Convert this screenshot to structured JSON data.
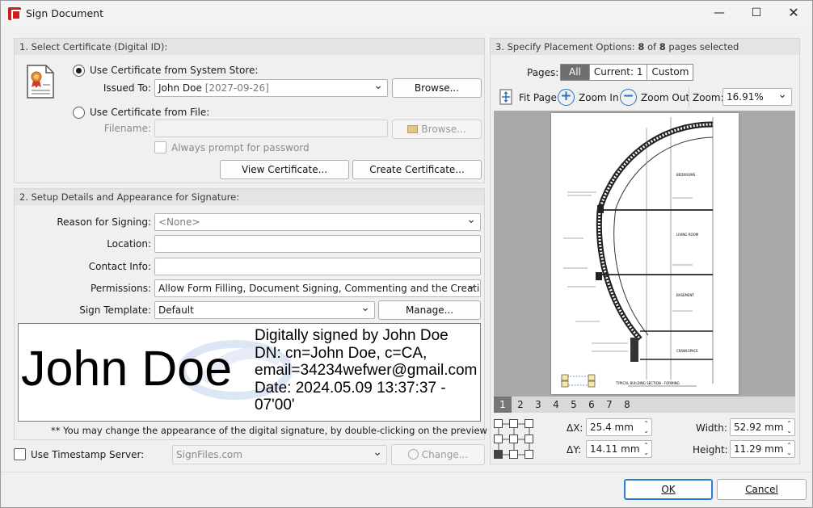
{
  "window": {
    "title": "Sign Document",
    "controls": {
      "minimize": "—",
      "maximize": "☐",
      "close": "✕"
    }
  },
  "certificate": {
    "section_title": "1. Select Certificate (Digital ID):",
    "system_store_label": "Use Certificate from System Store:",
    "issued_to_label": "Issued To:",
    "issued_to_name": "John Doe",
    "issued_to_date": "[2027-09-26]",
    "browse_label": "Browse...",
    "file_label": "Use Certificate from File:",
    "filename_label": "Filename:",
    "filename_value": "",
    "browse_file_label": "Browse...",
    "always_prompt_label": "Always prompt for password",
    "view_certificate_label": "View Certificate...",
    "create_certificate_label": "Create Certificate..."
  },
  "details": {
    "section_title": "2. Setup Details and Appearance for Signature:",
    "reason_label": "Reason for Signing:",
    "reason_value": "<None>",
    "location_label": "Location:",
    "location_value": "",
    "contact_label": "Contact Info:",
    "contact_value": "",
    "permissions_label": "Permissions:",
    "permissions_value": "Allow Form Filling, Document Signing, Commenting and the Creation of",
    "template_label": "Sign Template:",
    "template_value": "Default",
    "manage_label": "Manage...",
    "preview": {
      "name": "John Doe",
      "lines": [
        "Digitally signed by John Doe",
        "DN: cn=John Doe, c=CA,",
        "email=34234wefwer@gmail.com",
        "Date: 2024.05.09 13:37:37 -",
        "07'00'"
      ]
    },
    "hint": "** You may change the appearance of the digital signature, by double-clicking on the preview above."
  },
  "timestamp": {
    "label": "Use Timestamp Server:",
    "server_value": "SignFiles.com",
    "change_label": "Change..."
  },
  "placement": {
    "section_title_prefix": "3. Specify Placement Options: ",
    "selected_count": "8",
    "of_text": " of ",
    "total_count": "8",
    "suffix_text": " pages selected",
    "pages_label": "Pages:",
    "pages_options": [
      "All",
      "Current: 1",
      "Custom"
    ],
    "fit_page_label": "Fit Page",
    "zoom_in_label": "Zoom In",
    "zoom_out_label": "Zoom Out",
    "zoom_label": "Zoom:",
    "zoom_value": "16.91%",
    "drawing_labels": {
      "bedrooms": "BEDROOMS",
      "living_room": "LIVING ROOM",
      "basement": "BASEMENT",
      "crawlspace": "CRAWLSPACE",
      "section_title": "TYPICAL BUILDING SECTION - FORMING"
    },
    "page_tabs": [
      "1",
      "2",
      "3",
      "4",
      "5",
      "6",
      "7",
      "8"
    ],
    "dx_label": "ΔX:",
    "dx_value": "25.4 mm",
    "dy_label": "ΔY:",
    "dy_value": "14.11 mm",
    "width_label": "Width:",
    "width_value": "52.92 mm",
    "height_label": "Height:",
    "height_value": "11.29 mm"
  },
  "footer": {
    "ok_label": "OK",
    "cancel_label": "Cancel"
  },
  "colors": {
    "accent": "#2b6fc2",
    "app_icon": "#c8211c",
    "preview_bg": "#a9a9a9"
  }
}
